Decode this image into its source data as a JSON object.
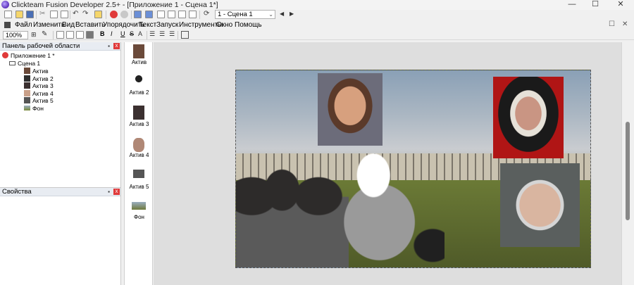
{
  "window": {
    "title": "Clickteam Fusion Developer 2.5+ - [Приложение 1 - Сцена 1*]",
    "minimize": "—",
    "maximize": "☐",
    "close": "✕"
  },
  "toolbar1": {
    "frame_select_value": "1 - Сцена 1",
    "prev_frame": "◀",
    "next_frame": "▶"
  },
  "menu": {
    "items": [
      "Файл",
      "Изменить",
      "Вид",
      "Вставить",
      "Упорядочить",
      "Текст",
      "Запуск",
      "Инструменты",
      "Окно",
      "Помощь"
    ],
    "restore": "☐",
    "close": "✕"
  },
  "toolbar2": {
    "zoom_value": "100%",
    "bold": "B",
    "italic": "I",
    "underline": "U",
    "strike": "S"
  },
  "workspace_panel": {
    "title": "Панель рабочей области",
    "pin": "▪",
    "close": "x",
    "tree": {
      "app": "Приложение 1 *",
      "frame": "Сцена 1",
      "objects": [
        "Актив",
        "Актив 2",
        "Актив 3",
        "Актив 4",
        "Актив 5",
        "Фон"
      ]
    }
  },
  "properties_panel": {
    "title": "Свойства",
    "pin": "▪",
    "close": "x"
  },
  "object_bar": {
    "items": [
      "Актив",
      "Актив 2",
      "Актив 3",
      "Актив 4",
      "Актив 5",
      "Фон"
    ]
  },
  "colors": {
    "accent_red": "#e03a3a",
    "panel_header": "#e8ecf2",
    "editor_bg": "#dedede"
  }
}
